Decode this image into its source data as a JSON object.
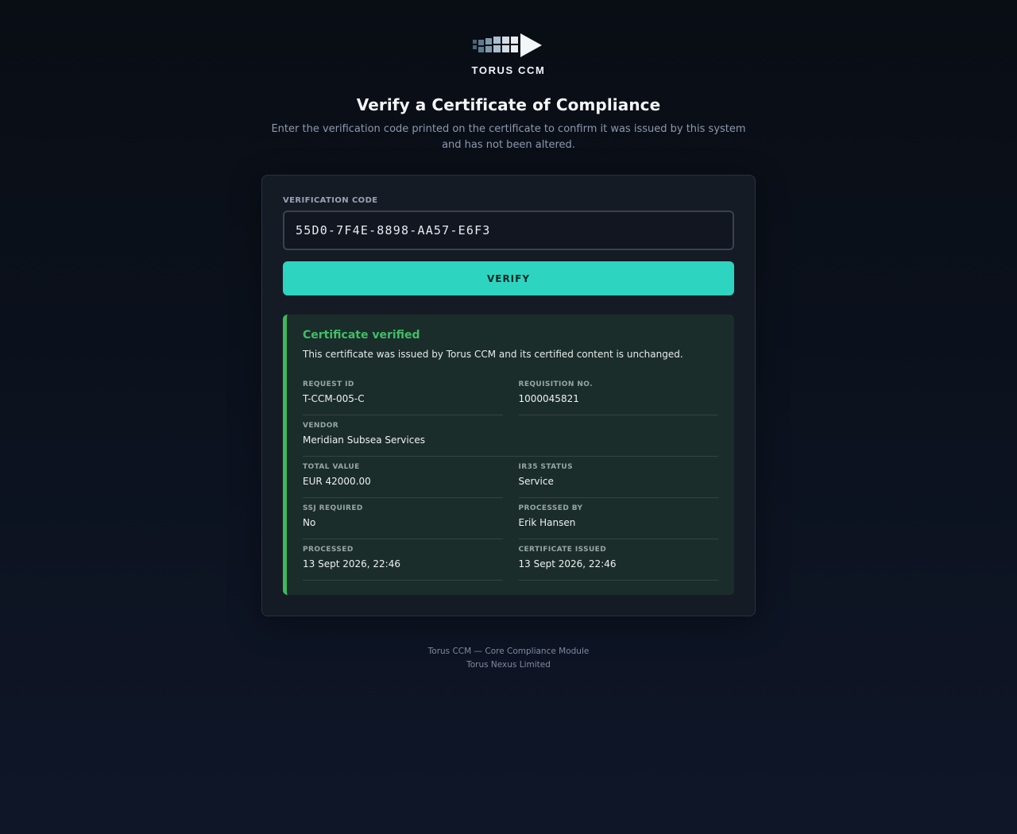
{
  "brand": {
    "name": "TORUS CCM",
    "logo_icon": "arrow-blocks-logo"
  },
  "header": {
    "title": "Verify a Certificate of Compliance",
    "subtitle": "Enter the verification code printed on the certificate to confirm it was issued by this system and has not been altered."
  },
  "form": {
    "code_label": "VERIFICATION CODE",
    "code_value": "55D0-7F4E-8898-AA57-E6F3",
    "verify_label": "VERIFY"
  },
  "result": {
    "title": "Certificate verified",
    "description": "This certificate was issued by Torus CCM and its certified content is unchanged.",
    "status_color": "#3fb85c",
    "fields": {
      "request_id": {
        "label": "REQUEST ID",
        "value": "T-CCM-005-C"
      },
      "requisition_no": {
        "label": "REQUISITION NO.",
        "value": "1000045821"
      },
      "vendor": {
        "label": "VENDOR",
        "value": "Meridian Subsea Services"
      },
      "total_value": {
        "label": "TOTAL VALUE",
        "value": "EUR 42000.00"
      },
      "ir35_status": {
        "label": "IR35 STATUS",
        "value": "Service"
      },
      "ssj_required": {
        "label": "SSJ REQUIRED",
        "value": "No"
      },
      "processed_by": {
        "label": "PROCESSED BY",
        "value": "Erik Hansen"
      },
      "processed": {
        "label": "PROCESSED",
        "value": "13 Sept 2026, 22:46"
      },
      "certificate_issued": {
        "label": "CERTIFICATE ISSUED",
        "value": "13 Sept 2026, 22:46"
      }
    }
  },
  "footer": {
    "line1": "Torus CCM — Core Compliance Module",
    "line2": "Torus Nexus Limited"
  },
  "colors": {
    "accent": "#2dd4bf",
    "success": "#3fb85c"
  }
}
